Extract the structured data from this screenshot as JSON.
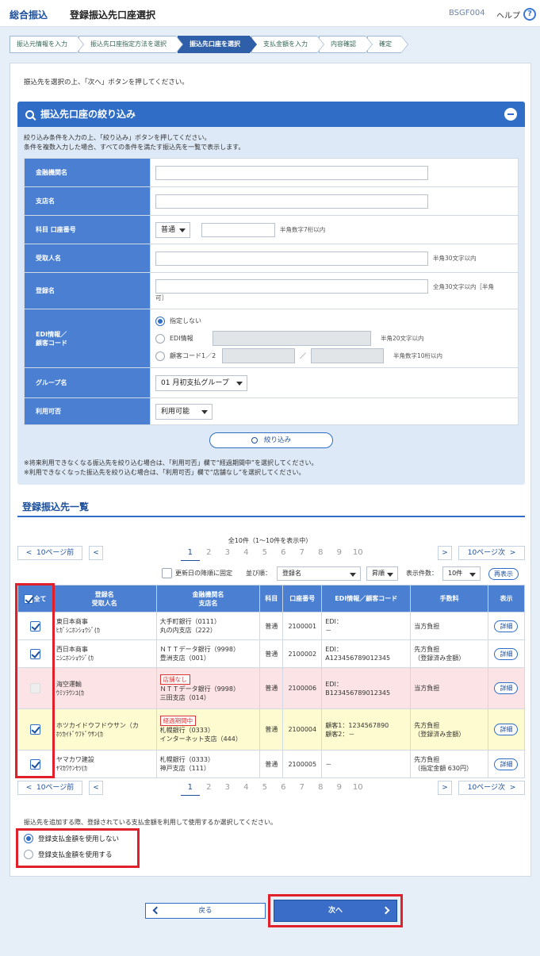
{
  "header": {
    "category": "総合振込",
    "title": "登録振込先口座選択",
    "screen_code": "BSGF004",
    "help_label": "ヘルプ",
    "help_icon": "?"
  },
  "steps": [
    "振込元情報を入力",
    "振込先口座指定方法を選択",
    "振込先口座を選択",
    "支払金額を入力",
    "内容確認",
    "確定"
  ],
  "active_step": 2,
  "instruction": "振込先を選択の上、「次へ」ボタンを押してください。",
  "filter": {
    "title": "振込先口座の絞り込み",
    "desc1": "絞り込み条件を入力の上、「絞り込み」ボタンを押してください。",
    "desc2": "条件を複数入力した場合、すべての条件を満たす振込先を一覧で表示します。",
    "labels": {
      "bank": "金融機関名",
      "branch": "支店名",
      "account": "科目 口座番号",
      "payee": "受取人名",
      "regname": "登録名",
      "edi": "EDI情報／",
      "edi2": "顧客コード",
      "group": "グループ名",
      "usable": "利用可否"
    },
    "account_type": "普通",
    "account_note": "半角数字7桁以内",
    "payee_note": "半角30文字以内",
    "regname_note": "全角30文字以内［半角",
    "regname_note2": "可］",
    "edi_opt1": "指定しない",
    "edi_opt2": "EDI情報",
    "edi_opt2_note": "半角20文字以内",
    "edi_opt3": "顧客コード1／2",
    "edi_sep": "／",
    "edi_opt3_note": "半角数字10桁以内",
    "group_value": "01 月初支払グループ",
    "usable_value": "利用可能",
    "button": "絞り込み",
    "note1": "※将来利用できなくなる振込先を絞り込む場合は、「利用可否」欄で“経過期間中”を選択してください。",
    "note2": "※利用できなくなった振込先を絞り込む場合は、「利用可否」欄で“店舗なし”を選択してください。"
  },
  "list": {
    "title": "登録振込先一覧",
    "count": "全10件（1～10件を表示中）",
    "prev10": "10ページ前",
    "next10": "10ページ次",
    "pages": [
      "1",
      "2",
      "3",
      "4",
      "5",
      "6",
      "7",
      "8",
      "9",
      "10"
    ],
    "current_page": "1",
    "fix_label": "更新日の降順に固定",
    "sort_label": "並び順：",
    "sort_value": "登録名",
    "order_value": "昇順",
    "display_label": "表示件数：",
    "display_value": "10件",
    "redisplay": "再表示",
    "headers": {
      "all": "全て",
      "name1": "登録名",
      "name2": "受取人名",
      "bank1": "金融機関名",
      "bank2": "支店名",
      "kamoku": "科目",
      "account": "口座番号",
      "edi": "EDI情報／顧客コード",
      "fee": "手数料",
      "show": "表示"
    },
    "rows": [
      {
        "name": "東日本商事",
        "kana": "ﾋｶﾞｼﾆﾎﾝｼｮｳｼﾞ(ｶ",
        "tag": "",
        "bank": "大手町銀行（0111）",
        "branch": "丸の内支店（222）",
        "kamoku": "普通",
        "account": "2100001",
        "edi1": "EDI：",
        "edi2": "－",
        "fee1": "当方負担",
        "fee2": "",
        "detail": "詳細",
        "checked": true,
        "style": ""
      },
      {
        "name": "西日本商事",
        "kana": "ﾆｼﾆﾎﾝｼｮｳｼﾞ(ｶ",
        "tag": "",
        "bank": "ＮＴＴデータ銀行（9998）",
        "branch": "豊洲支店（001）",
        "kamoku": "普通",
        "account": "2100002",
        "edi1": "EDI：",
        "edi2": "A123456789012345",
        "fee1": "先方負担",
        "fee2": "（登録済み金額）",
        "detail": "詳細",
        "checked": true,
        "style": ""
      },
      {
        "name": "海空運輸",
        "kana": "ｳﾐｿﾗｳﾝﾕ(ｶ",
        "tag": "店舗なし",
        "bank": "ＮＴＴデータ銀行（9998）",
        "branch": "三田支店（014）",
        "kamoku": "普通",
        "account": "2100006",
        "edi1": "EDI：",
        "edi2": "B123456789012345",
        "fee1": "当方負担",
        "fee2": "",
        "detail": "詳細",
        "checked": false,
        "style": "pink"
      },
      {
        "name": "ホツカイドウフドウサン（カ",
        "kana": "ﾎﾂｶｲﾄﾞｳﾌﾄﾞｳｻﾝ(ｶ",
        "tag": "経過期間中",
        "bank": "札幌銀行（0333）",
        "branch": "インターネット支店（444）",
        "kamoku": "普通",
        "account": "2100004",
        "edi1": "顧客1：1234567890",
        "edi2": "顧客2：－",
        "fee1": "先方負担",
        "fee2": "（登録済み金額）",
        "detail": "詳細",
        "checked": true,
        "style": "yel"
      },
      {
        "name": "ヤマカワ建設",
        "kana": "ﾔﾏｶﾜｹﾝｾﾂ(ｶ",
        "tag": "",
        "bank": "札幌銀行（0333）",
        "branch": "神戸支店（111）",
        "kamoku": "普通",
        "account": "2100005",
        "edi1": "－",
        "edi2": "",
        "fee1": "先方負担",
        "fee2": "（指定金額 630円）",
        "detail": "詳細",
        "checked": true,
        "style": ""
      }
    ]
  },
  "amount_question": "振込先を追加する際、登録されている支払金額を利用して使用するか選択してください。",
  "amount_opt1": "登録支払金額を使用しない",
  "amount_opt2": "登録支払金額を使用する",
  "footer": {
    "back": "戻る",
    "next": "次へ"
  },
  "colors": {
    "accent": "#2f6dc6",
    "header_blue": "#4a7fd2",
    "highlight": "#e0202a",
    "pink_row": "#fbe3e6",
    "yellow_row": "#fdfbcf"
  }
}
